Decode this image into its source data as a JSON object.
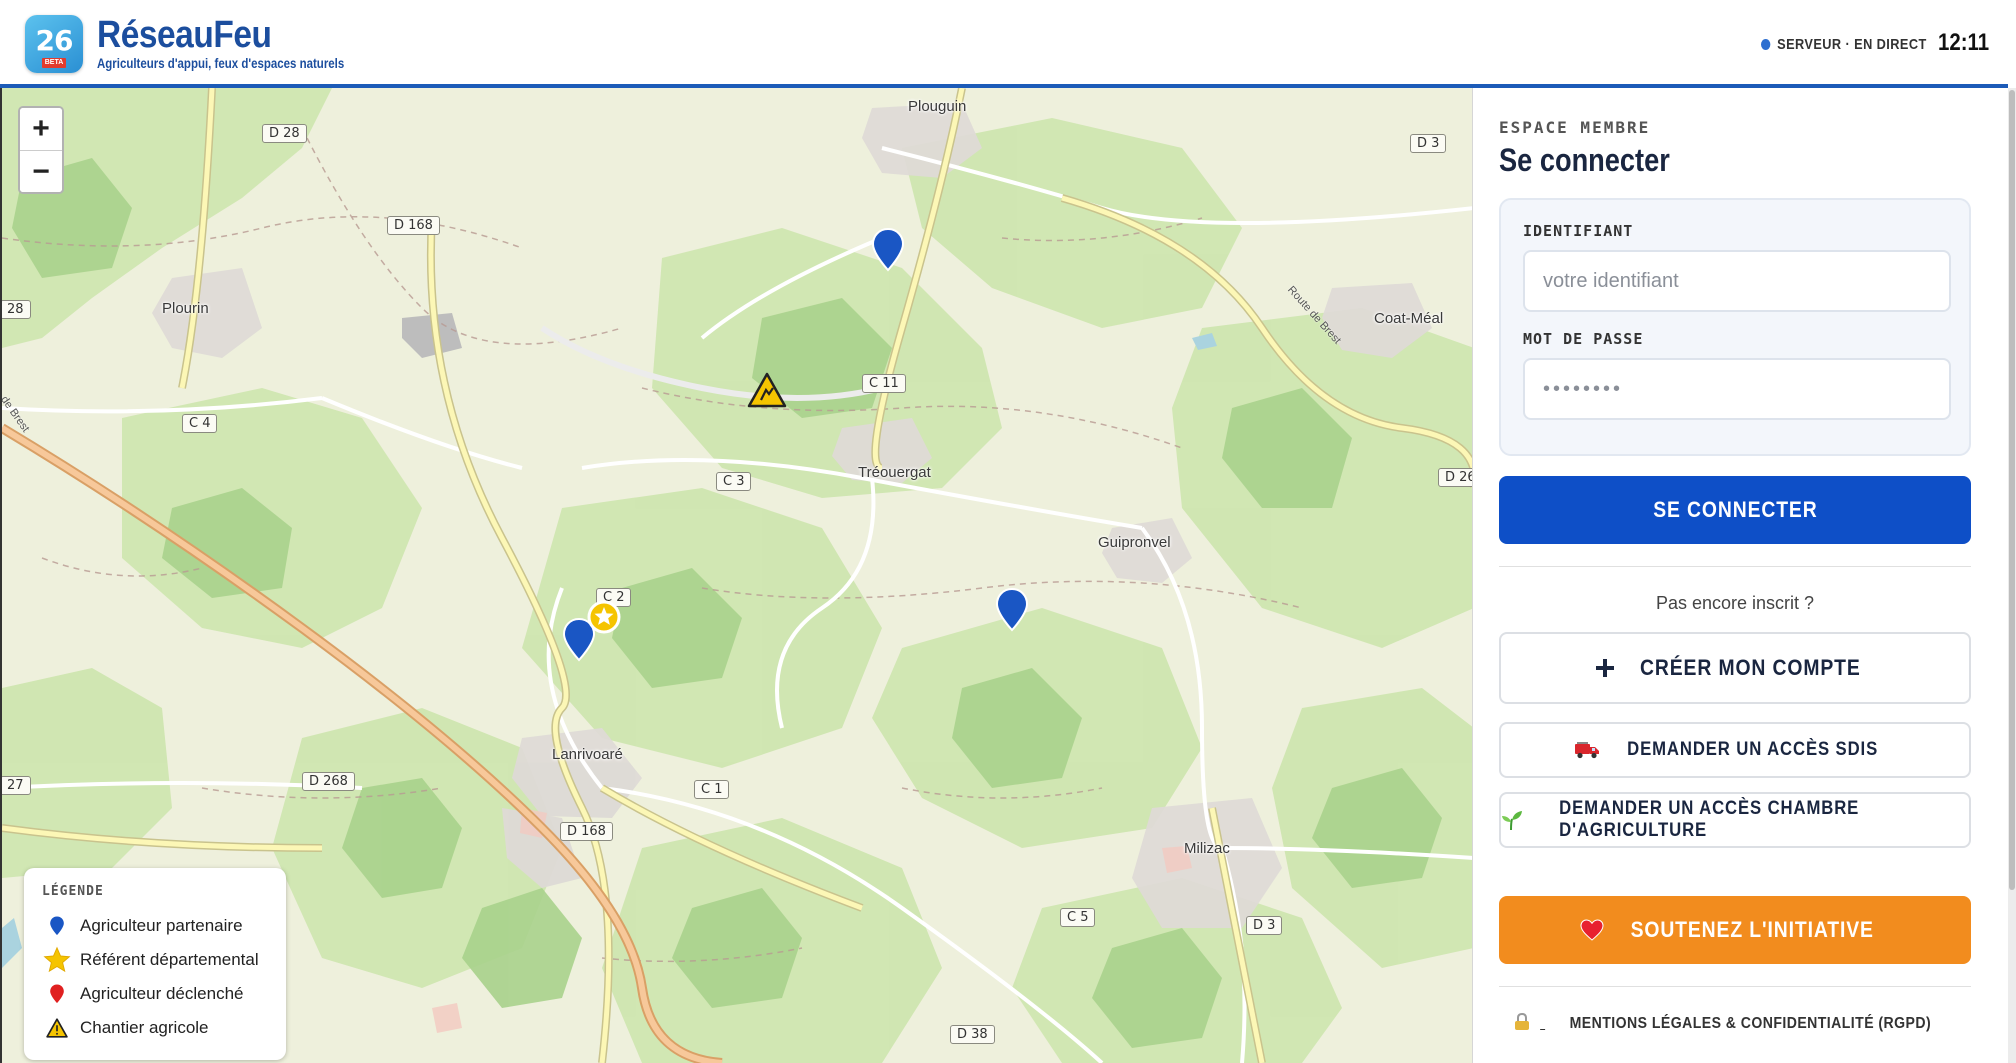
{
  "header": {
    "logo_number": "26",
    "logo_tag": "BETA",
    "title": "RéseauFeu",
    "subtitle": "Agriculteurs d'appui, feux d'espaces naturels",
    "status": "SERVEUR · EN DIRECT",
    "clock": "12:11"
  },
  "map": {
    "zoom_in": "+",
    "zoom_out": "−",
    "road_labels": [
      "D 28",
      "D 168",
      "28",
      "C 4",
      "D 3",
      "C 11",
      "C 3",
      "D 26",
      "C 2",
      "D 268",
      "C 1",
      "D 168",
      "27",
      "C 5",
      "D 3",
      "D 38"
    ],
    "places": [
      "Plouguin",
      "Plourin",
      "Coat-Méal",
      "Tréouergat",
      "Guipronvel",
      "Lanrivoaré",
      "Milizac"
    ],
    "road_names": [
      "Route de Brest",
      "de Brest"
    ],
    "legend": {
      "title": "LÉGENDE",
      "items": [
        {
          "label": "Agriculteur partenaire",
          "icon": "blue-pin-icon",
          "color": "#1a56c4"
        },
        {
          "label": "Référent départemental",
          "icon": "star-icon",
          "color": "#f5c400"
        },
        {
          "label": "Agriculteur déclenché",
          "icon": "red-pin-icon",
          "color": "#e02020"
        },
        {
          "label": "Chantier agricole",
          "icon": "warning-icon",
          "color": "#f5c400"
        }
      ]
    }
  },
  "panel": {
    "eyebrow": "ESPACE MEMBRE",
    "title": "Se connecter",
    "identifiant_label": "IDENTIFIANT",
    "identifiant_placeholder": "votre identifiant",
    "password_label": "MOT DE PASSE",
    "password_placeholder": "••••••••",
    "login_button": "SE CONNECTER",
    "not_registered": "Pas encore inscrit ?",
    "create_button": "CRÉER MON COMPTE",
    "sdis_button": "DEMANDER UN ACCÈS SDIS",
    "chambre_button": "DEMANDER UN ACCÈS CHAMBRE D'AGRICULTURE",
    "support_button": "SOUTENEZ L'INITIATIVE",
    "legal_link": "MENTIONS LÉGALES & CONFIDENTIALITÉ (RGPD)"
  },
  "colors": {
    "primary": "#0e4fc7",
    "accent": "#f28c1e",
    "brand": "#1c4e9e",
    "map_background": "#eef0dc"
  }
}
